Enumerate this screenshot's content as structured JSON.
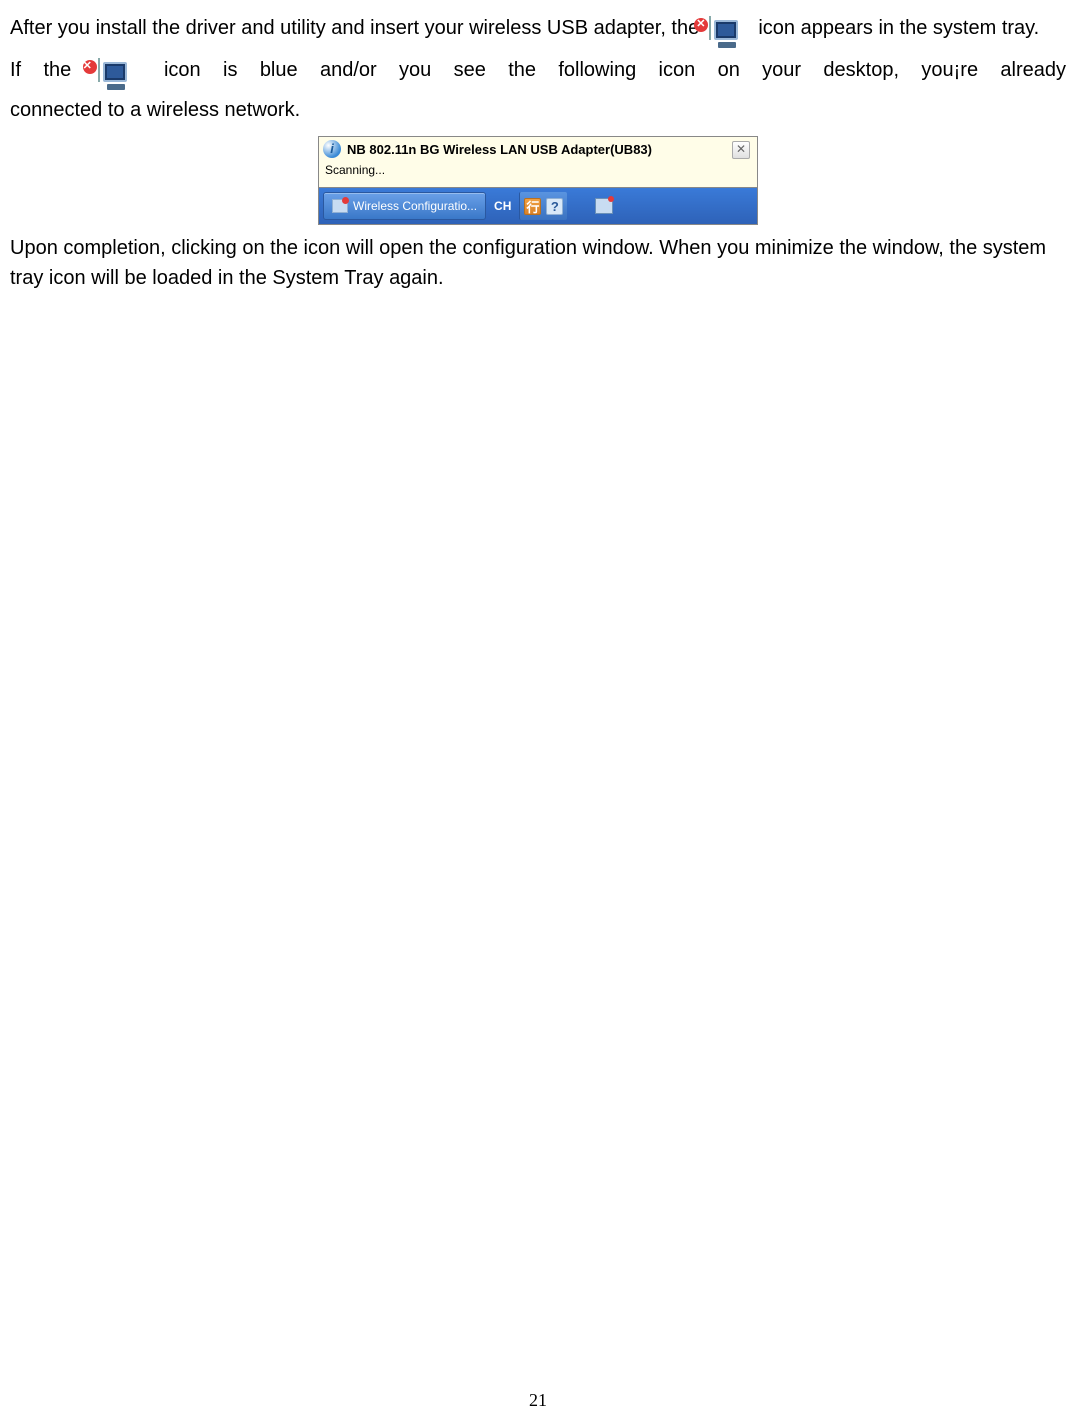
{
  "para1_a": "After you install the driver and utility and insert your wireless USB adapter, the ",
  "para1_b": " icon appears in the system tray.",
  "para2_line1_a": "If the ",
  "para2_line1_b": " icon is blue and/or you see the following icon on your desktop, you¡re already",
  "para2_line2": "connected to a wireless network.",
  "balloon": {
    "title": "NB 802.11n BG Wireless LAN USB Adapter(UB83)",
    "body": "Scanning...",
    "close": "✕",
    "info": "i"
  },
  "taskbar": {
    "button_label": "Wireless Configuratio...",
    "lang": "CH",
    "ime": "行",
    "help": "?"
  },
  "para3": "Upon completion, clicking on the icon will open the configuration window. When you minimize the window, the system tray icon will be loaded in the System Tray again.",
  "page_number": "21"
}
